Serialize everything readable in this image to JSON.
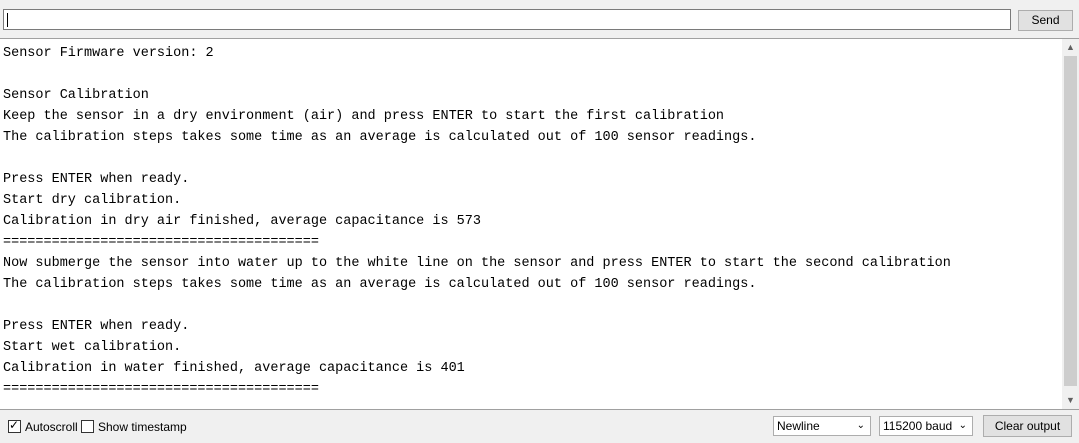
{
  "header": {
    "input_value": "",
    "send_label": "Send"
  },
  "output": {
    "lines": [
      "Sensor Firmware version: 2",
      "",
      "Sensor Calibration",
      "Keep the sensor in a dry environment (air) and press ENTER to start the first calibration",
      "The calibration steps takes some time as an average is calculated out of 100 sensor readings.",
      "",
      "Press ENTER when ready.",
      "Start dry calibration.",
      "Calibration in dry air finished, average capacitance is 573",
      "=======================================",
      "Now submerge the sensor into water up to the white line on the sensor and press ENTER to start the second calibration",
      "The calibration steps takes some time as an average is calculated out of 100 sensor readings.",
      "",
      "Press ENTER when ready.",
      "Start wet calibration.",
      "Calibration in water finished, average capacitance is 401",
      "======================================="
    ]
  },
  "footer": {
    "autoscroll_label": "Autoscroll",
    "autoscroll_checked": true,
    "timestamp_label": "Show timestamp",
    "timestamp_checked": false,
    "line_ending": "Newline",
    "baud_rate": "115200 baud",
    "clear_label": "Clear output"
  },
  "icons": {
    "scroll_up": "chevron-up-icon",
    "scroll_down": "chevron-down-icon",
    "dropdown": "chevron-down-icon"
  }
}
